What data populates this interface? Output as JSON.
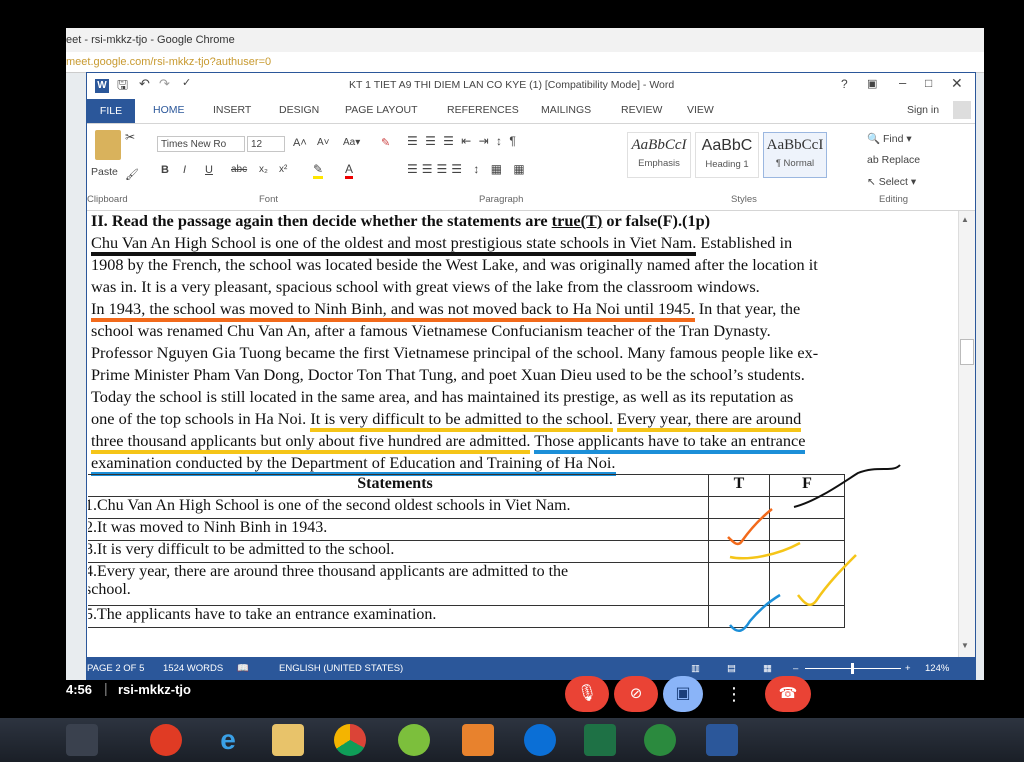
{
  "chrome": {
    "title": "eet - rsi-mkkz-tjo - Google Chrome",
    "address": "meet.google.com/rsi-mkkz-tjo?authuser=0"
  },
  "word": {
    "doc_title": "KT 1 TIET A9 THI DIEM LAN CO KYE (1) [Compatibility Mode] - Word",
    "sign_in": "Sign in",
    "tabs": [
      "FILE",
      "HOME",
      "INSERT",
      "DESIGN",
      "PAGE LAYOUT",
      "REFERENCES",
      "MAILINGS",
      "REVIEW",
      "VIEW"
    ],
    "ribbon": {
      "paste": "Paste",
      "font_name": "Times New Ro",
      "font_size": "12",
      "find": "Find",
      "replace": "Replace",
      "select": "Select",
      "groups": [
        "Clipboard",
        "Font",
        "Paragraph",
        "Styles",
        "Editing"
      ],
      "styles": [
        {
          "sample": "AaBbCcI",
          "name": "Emphasis"
        },
        {
          "sample": "AaBbC",
          "name": "Heading 1"
        },
        {
          "sample": "AaBbCcI",
          "name": "¶ Normal"
        }
      ]
    },
    "document": {
      "heading_pre": "II. Read the passage again then decide whether the statements are ",
      "heading_tf": "true(T)",
      "heading_post": " or false(F).(1p)",
      "l1a": "Chu Van An High School is one of the oldest and most prestigious state schools in Viet Nam.",
      "l1b": " Established in",
      "l2": "1908 by the French, the school was located beside the West Lake, and was originally named after the location it",
      "l3": "was in. It is a very pleasant, spacious school with great views of the lake from the classroom windows.",
      "l4a": "In 1943, the school was moved to Ninh Binh, and was not moved back to Ha Noi until 1945.",
      "l4b": " In that year, the",
      "l5": "school was renamed Chu Van An, after a famous Vietnamese Confucianism teacher of the Tran Dynasty.",
      "l6": "Professor Nguyen Gia Tuong became the first Vietnamese principal of the school. Many famous people like ex-",
      "l7": "Prime Minister Pham Van Dong, Doctor Ton That Tung, and poet Xuan Dieu used to be the school’s students.",
      "l8": "Today the school is still located in the same area, and has maintained its prestige, as well as its reputation as",
      "l9a": "one of the top schools in Ha Noi. ",
      "l9b": "It is very difficult to be admitted to the school.",
      "l9c": " ",
      "l9d": "Every year, there are around",
      "l10a": "three thousand applicants but only about five hundred are admitted.",
      "l10b": " ",
      "l10c": "Those applicants have to take an entrance",
      "l11": "examination conducted by the Department of Education and Training of Ha Noi."
    },
    "table": {
      "headers": [
        "Statements",
        "T",
        "F"
      ],
      "rows": [
        "1.Chu Van An High School is one of the second  oldest schools in Viet Nam.",
        "2.It was moved to Ninh Binh in 1943.",
        "3.It is very difficult to be admitted to the school.",
        "4.Every year, there are around three thousand applicants are admitted to the",
        "school.",
        "5.The applicants have to take an entrance examination."
      ]
    },
    "status": {
      "page": "PAGE 2 OF 5",
      "words": "1524 WORDS",
      "language": "ENGLISH (UNITED STATES)",
      "zoom": "124%"
    }
  },
  "meet": {
    "time": "4:56",
    "code": "rsi-mkkz-tjo"
  },
  "colors": {
    "word_blue": "#2b579a",
    "underline_black": "#111111",
    "underline_orange": "#f26a1b",
    "underline_yellow": "#f5c518",
    "underline_blue": "#1c8fd8",
    "hangup_red": "#ea4335"
  }
}
